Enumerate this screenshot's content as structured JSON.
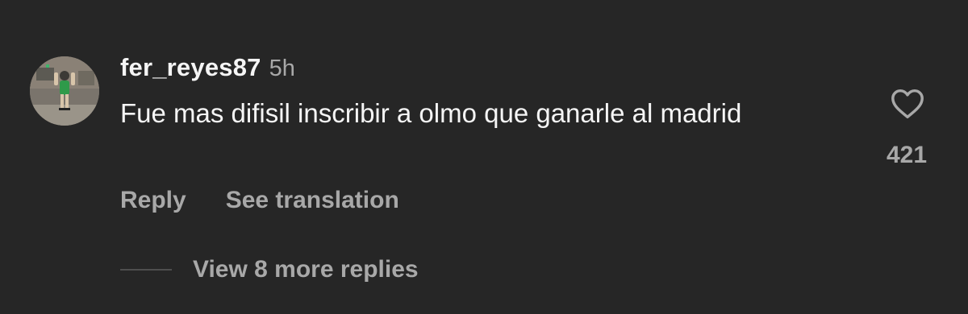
{
  "comment": {
    "username": "fer_reyes87",
    "timestamp": "5h",
    "text": "Fue mas difisil inscribir a olmo que ganarle al madrid",
    "actions": {
      "reply": "Reply",
      "translate": "See translation"
    },
    "like_count": "421",
    "replies_label": "View 8 more replies"
  },
  "icons": {
    "like": "heart-icon"
  },
  "colors": {
    "background": "#262626",
    "primary_text": "#f5f5f5",
    "secondary_text": "#a8a8a8"
  }
}
